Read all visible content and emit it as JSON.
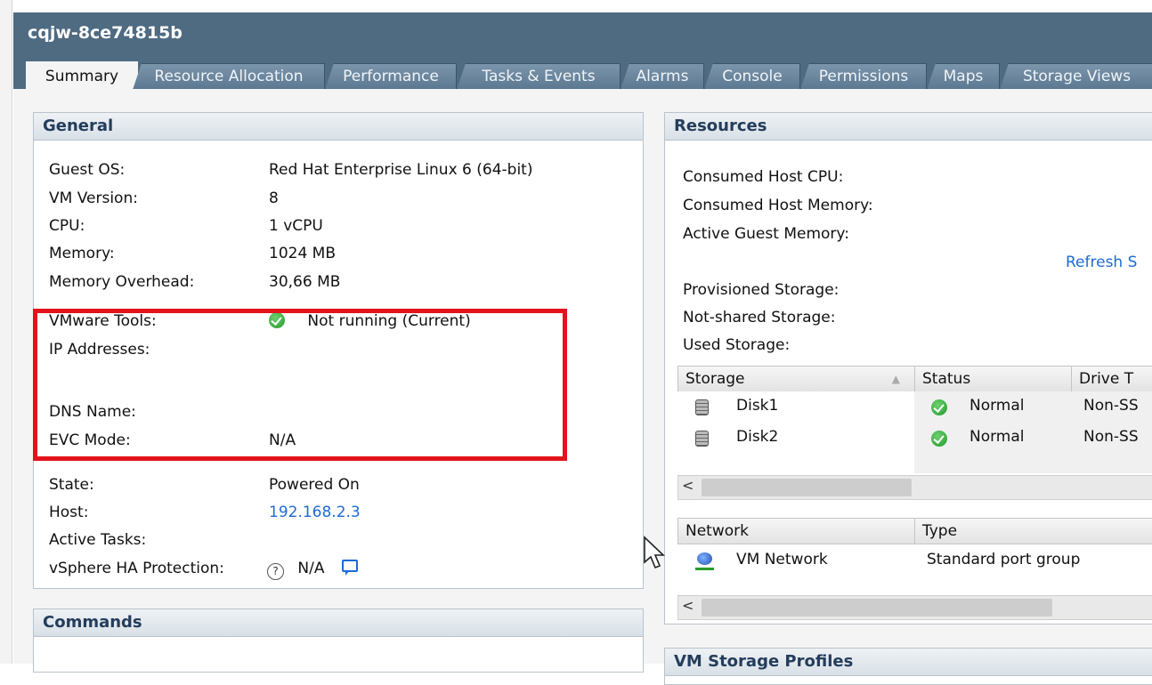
{
  "window": {
    "title": "cqjw-8ce74815b"
  },
  "tabs": [
    {
      "label": "Summary",
      "active": true
    },
    {
      "label": "Resource Allocation"
    },
    {
      "label": "Performance"
    },
    {
      "label": "Tasks & Events"
    },
    {
      "label": "Alarms"
    },
    {
      "label": "Console"
    },
    {
      "label": "Permissions"
    },
    {
      "label": "Maps"
    },
    {
      "label": "Storage Views"
    }
  ],
  "general": {
    "header": "General",
    "guest_os_label": "Guest OS:",
    "guest_os_value": "Red Hat Enterprise Linux 6 (64-bit)",
    "vm_version_label": "VM Version:",
    "vm_version_value": "8",
    "cpu_label": "CPU:",
    "cpu_value": "1 vCPU",
    "memory_label": "Memory:",
    "memory_value": "1024 MB",
    "memory_overhead_label": "Memory Overhead:",
    "memory_overhead_value": "30,66 MB",
    "vmware_tools_label": "VMware Tools:",
    "vmware_tools_value": "Not running (Current)",
    "ip_addresses_label": "IP Addresses:",
    "dns_name_label": "DNS Name:",
    "evc_mode_label": "EVC Mode:",
    "evc_mode_value": "N/A",
    "state_label": "State:",
    "state_value": "Powered On",
    "host_label": "Host:",
    "host_value": "192.168.2.3",
    "active_tasks_label": "Active Tasks:",
    "ha_label": "vSphere HA Protection:",
    "ha_value": "N/A"
  },
  "commands": {
    "header": "Commands"
  },
  "resources": {
    "header": "Resources",
    "consumed_cpu_label": "Consumed Host CPU:",
    "consumed_memory_label": "Consumed Host Memory:",
    "active_guest_memory_label": "Active Guest Memory:",
    "refresh_link": "Refresh S",
    "provisioned_storage_label": "Provisioned Storage:",
    "not_shared_storage_label": "Not-shared Storage:",
    "used_storage_label": "Used Storage:",
    "storage_table": {
      "headers": [
        "Storage",
        "Status",
        "Drive T"
      ],
      "rows": [
        {
          "name": "Disk1",
          "status": "Normal",
          "drive": "Non-SS"
        },
        {
          "name": "Disk2",
          "status": "Normal",
          "drive": "Non-SS"
        }
      ]
    },
    "network_table": {
      "headers": [
        "Network",
        "Type"
      ],
      "rows": [
        {
          "name": "VM Network",
          "type": "Standard port group"
        }
      ]
    }
  },
  "vm_storage_profiles": {
    "header": "VM Storage Profiles"
  },
  "colors": {
    "titlebar": "#4f6b82",
    "panel_header_text": "#243d5c",
    "link": "#1c6bd6",
    "highlight_box": "#e3131b"
  }
}
